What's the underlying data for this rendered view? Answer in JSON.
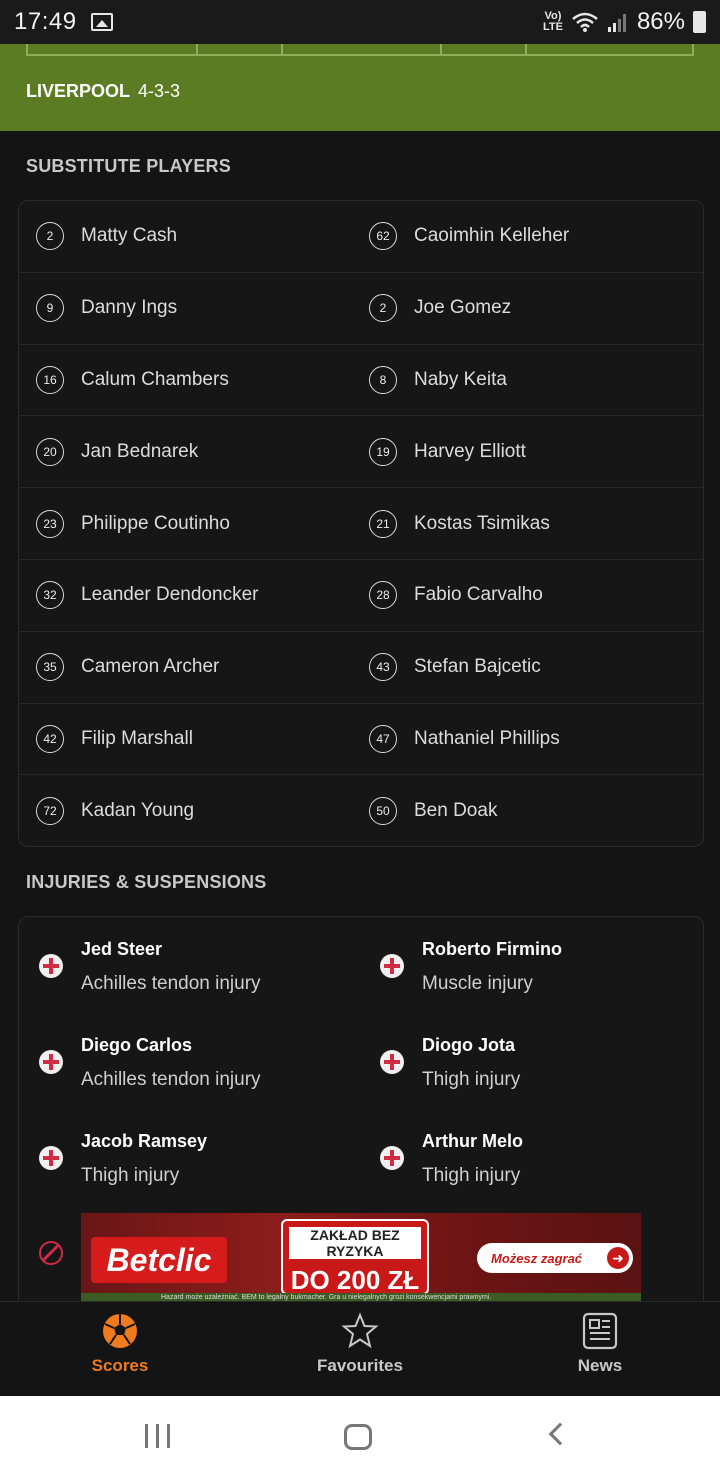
{
  "status_bar": {
    "time": "17:49",
    "network": "LTE",
    "battery": "86%"
  },
  "lineup": {
    "team": "LIVERPOOL",
    "formation": "4-3-3"
  },
  "substitutes": {
    "title": "SUBSTITUTE PLAYERS",
    "rows": [
      [
        {
          "num": "2",
          "name": "Matty Cash"
        },
        {
          "num": "62",
          "name": "Caoimhin Kelleher"
        }
      ],
      [
        {
          "num": "9",
          "name": "Danny Ings"
        },
        {
          "num": "2",
          "name": "Joe Gomez"
        }
      ],
      [
        {
          "num": "16",
          "name": "Calum Chambers"
        },
        {
          "num": "8",
          "name": "Naby Keita"
        }
      ],
      [
        {
          "num": "20",
          "name": "Jan Bednarek"
        },
        {
          "num": "19",
          "name": "Harvey Elliott"
        }
      ],
      [
        {
          "num": "23",
          "name": "Philippe Coutinho"
        },
        {
          "num": "21",
          "name": "Kostas Tsimikas"
        }
      ],
      [
        {
          "num": "32",
          "name": "Leander Dendoncker"
        },
        {
          "num": "28",
          "name": "Fabio Carvalho"
        }
      ],
      [
        {
          "num": "35",
          "name": "Cameron Archer"
        },
        {
          "num": "43",
          "name": "Stefan Bajcetic"
        }
      ],
      [
        {
          "num": "42",
          "name": "Filip Marshall"
        },
        {
          "num": "47",
          "name": "Nathaniel Phillips"
        }
      ],
      [
        {
          "num": "72",
          "name": "Kadan Young"
        },
        {
          "num": "50",
          "name": "Ben Doak"
        }
      ]
    ]
  },
  "injuries": {
    "title": "INJURIES & SUSPENSIONS",
    "rows": [
      [
        {
          "name": "Jed Steer",
          "reason": "Achilles tendon injury"
        },
        {
          "name": "Roberto Firmino",
          "reason": "Muscle injury"
        }
      ],
      [
        {
          "name": "Diego Carlos",
          "reason": "Achilles tendon injury"
        },
        {
          "name": "Diogo Jota",
          "reason": "Thigh injury"
        }
      ],
      [
        {
          "name": "Jacob Ramsey",
          "reason": "Thigh injury"
        },
        {
          "name": "Arthur Melo",
          "reason": "Thigh injury"
        }
      ]
    ]
  },
  "ad": {
    "brand": "Betclic",
    "offer_line1": "ZAKŁAD BEZ RYZYKA",
    "offer_line2": "DO 200 ZŁ",
    "cta": "Możesz zagrać",
    "fine_print": "Hazard może uzależniać. BEM to legalny bukmacher. Gra u nielegalnych grozi konsekwencjami prawnymi."
  },
  "bottom_nav": {
    "items": [
      {
        "label": "Scores",
        "icon": "soccer-ball-icon",
        "active": true
      },
      {
        "label": "Favourites",
        "icon": "star-icon",
        "active": false
      },
      {
        "label": "News",
        "icon": "newspaper-icon",
        "active": false
      }
    ]
  },
  "colors": {
    "accent": "#f07a1e",
    "pitch": "#5b7c23",
    "injury_red": "#d02a45"
  }
}
